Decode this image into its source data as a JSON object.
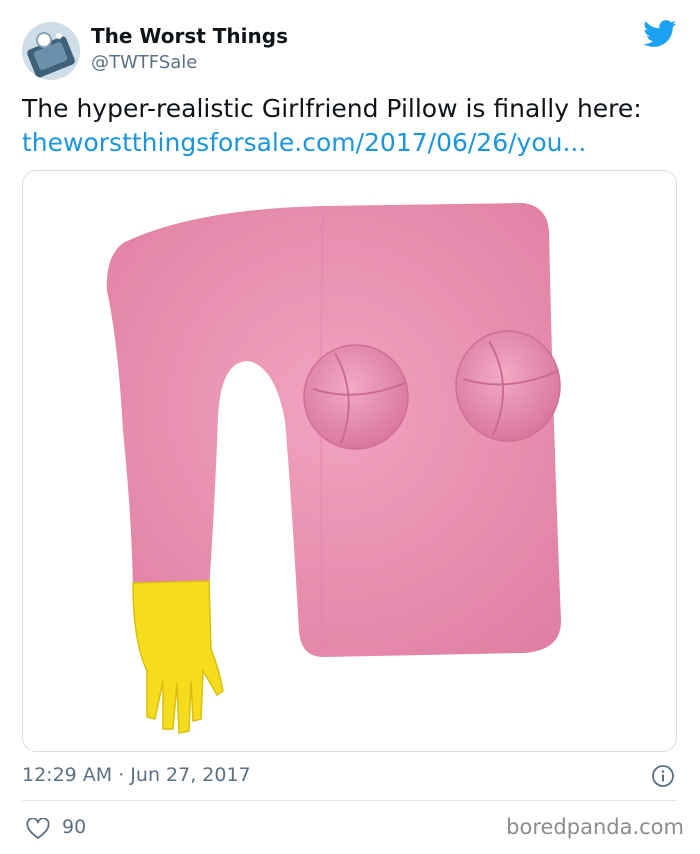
{
  "user": {
    "display_name": "The Worst Things",
    "handle": "@TWTFSale"
  },
  "tweet": {
    "text": "The hyper-realistic Girlfriend Pillow is finally here:",
    "link": "theworstthingsforsale.com/2017/06/26/you..."
  },
  "meta": {
    "timestamp": "12:29 AM · Jun 27, 2017",
    "likes": "90"
  },
  "watermark": "boredpanda.com",
  "icons": {
    "brand": "twitter-bird-icon",
    "info": "info-icon",
    "like": "heart-icon"
  },
  "colors": {
    "link": "#1b95e0",
    "bird": "#1da1f2",
    "secondary_text": "#5b7083",
    "pillow": "#ec93b3",
    "hand": "#f5dc1c"
  }
}
